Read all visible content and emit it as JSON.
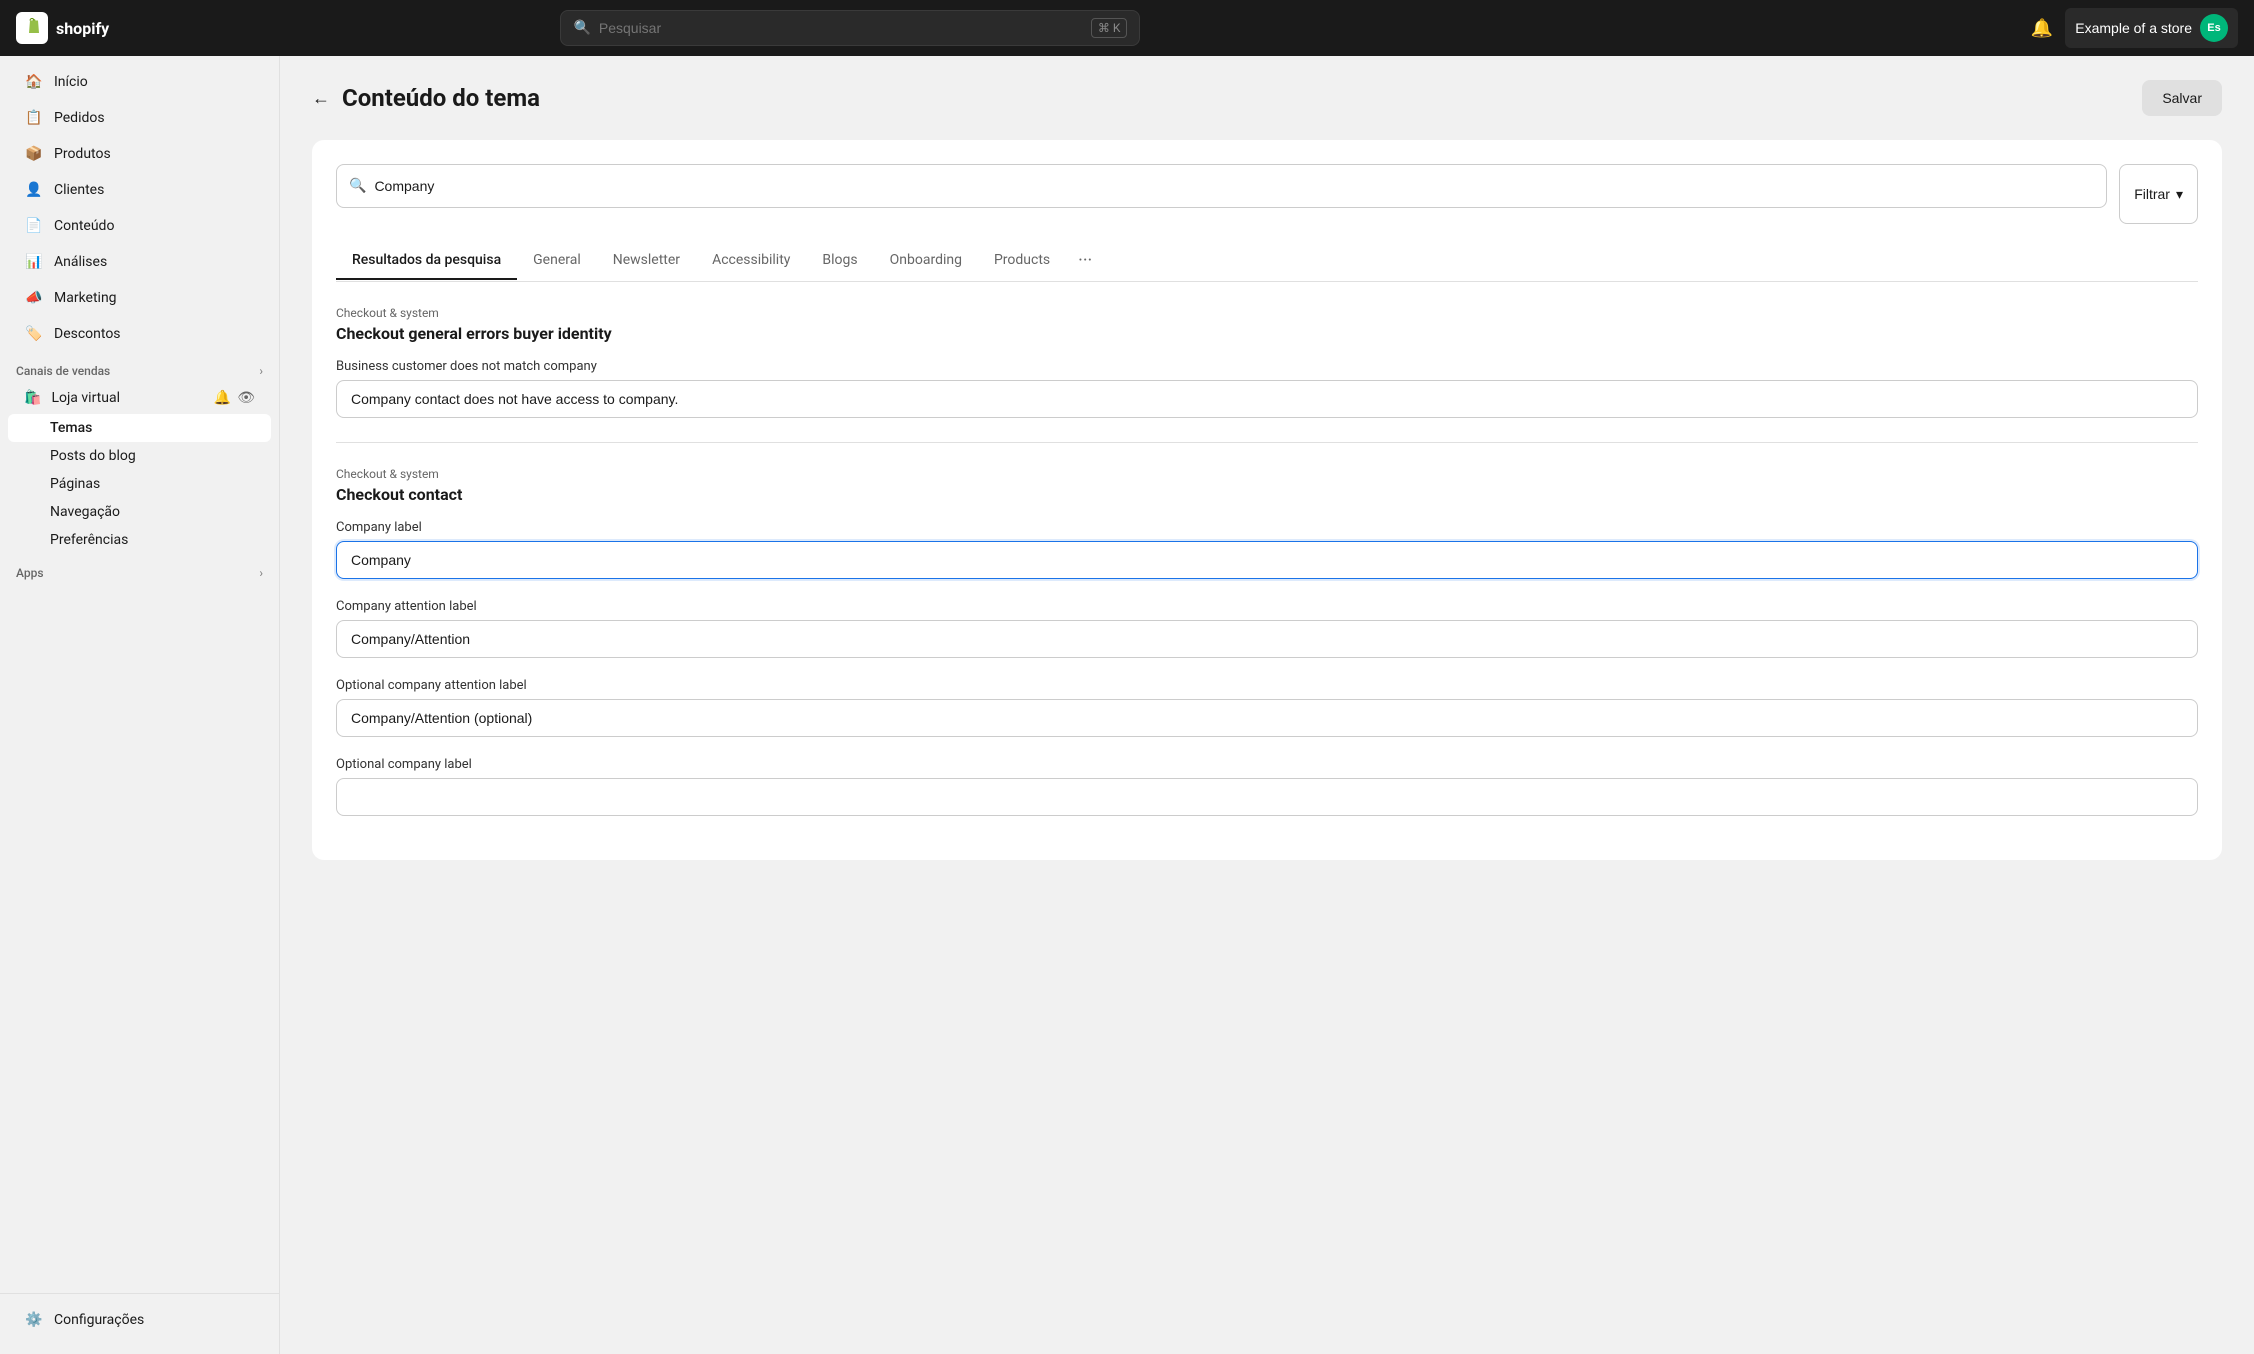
{
  "topbar": {
    "logo_text": "shopify",
    "search_placeholder": "Pesquisar",
    "search_shortcut": "⌘ K",
    "store_name": "Example of a store",
    "avatar_text": "Es"
  },
  "sidebar": {
    "items": [
      {
        "id": "inicio",
        "label": "Início",
        "icon": "home"
      },
      {
        "id": "pedidos",
        "label": "Pedidos",
        "icon": "orders"
      },
      {
        "id": "produtos",
        "label": "Produtos",
        "icon": "products"
      },
      {
        "id": "clientes",
        "label": "Clientes",
        "icon": "customers"
      },
      {
        "id": "conteudo",
        "label": "Conteúdo",
        "icon": "content"
      },
      {
        "id": "analises",
        "label": "Análises",
        "icon": "analytics"
      },
      {
        "id": "marketing",
        "label": "Marketing",
        "icon": "marketing"
      },
      {
        "id": "descontos",
        "label": "Descontos",
        "icon": "discounts"
      }
    ],
    "sales_channels_title": "Canais de vendas",
    "virtual_store": "Loja virtual",
    "sub_items": [
      {
        "id": "temas",
        "label": "Temas",
        "active": true
      },
      {
        "id": "posts",
        "label": "Posts do blog"
      },
      {
        "id": "paginas",
        "label": "Páginas"
      },
      {
        "id": "navegacao",
        "label": "Navegação"
      },
      {
        "id": "preferencias",
        "label": "Preferências"
      }
    ],
    "apps_title": "Apps",
    "configuracoes": "Configurações"
  },
  "page": {
    "title": "Conteúdo do tema",
    "save_label": "Salvar",
    "back_label": "←"
  },
  "content": {
    "search_value": "Company",
    "search_placeholder": "Company",
    "filter_label": "Filtrar",
    "tabs": [
      {
        "id": "results",
        "label": "Resultados da pesquisa",
        "active": true
      },
      {
        "id": "general",
        "label": "General"
      },
      {
        "id": "newsletter",
        "label": "Newsletter"
      },
      {
        "id": "accessibility",
        "label": "Accessibility"
      },
      {
        "id": "blogs",
        "label": "Blogs"
      },
      {
        "id": "onboarding",
        "label": "Onboarding"
      },
      {
        "id": "products",
        "label": "Products"
      }
    ],
    "sections": [
      {
        "id": "checkout-system-1",
        "section_label": "Checkout & system",
        "section_title": "Checkout general errors buyer identity",
        "fields": [
          {
            "id": "business-customer",
            "label": "Business customer does not match company",
            "value": "Company contact does not have access to company.",
            "focused": false
          }
        ]
      },
      {
        "id": "checkout-system-2",
        "section_label": "Checkout & system",
        "section_title": "Checkout contact",
        "fields": [
          {
            "id": "company-label",
            "label": "Company label",
            "value": "Company",
            "focused": true
          },
          {
            "id": "company-attention-label",
            "label": "Company attention label",
            "value": "Company/Attention",
            "focused": false
          },
          {
            "id": "optional-company-attention-label",
            "label": "Optional company attention label",
            "value": "Company/Attention (optional)",
            "focused": false
          },
          {
            "id": "optional-company-label",
            "label": "Optional company label",
            "value": "",
            "focused": false
          }
        ]
      }
    ]
  }
}
